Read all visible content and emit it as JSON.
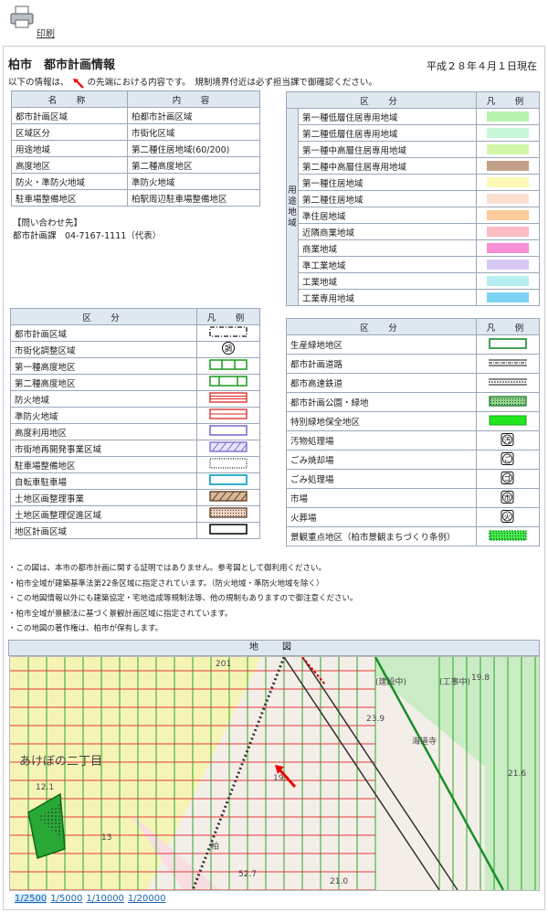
{
  "print": {
    "label": "印刷"
  },
  "header": {
    "title": "柏市　都市計画情報",
    "as_of": "平成２８年４月１日現在",
    "note_before": "以下の情報は、",
    "note_after": "の先端における内容です。　規制境界付近は必ず担当課で御確認ください。"
  },
  "info_table": {
    "headers": [
      "名　称",
      "内　容"
    ],
    "rows": [
      [
        "都市計画区域",
        "柏都市計画区域"
      ],
      [
        "区域区分",
        "市街化区域"
      ],
      [
        "用途地域",
        "第二種住居地域(60/200)"
      ],
      [
        "高度地区",
        "第二種高度地区"
      ],
      [
        "防火・準防火地域",
        "準防火地域"
      ],
      [
        "駐車場整備地区",
        "柏駅周辺駐車場整備地区"
      ]
    ]
  },
  "contact": {
    "heading": "【問い合わせ先】",
    "line": "都市計画課　04-7167-1111（代表）"
  },
  "zone_table": {
    "headers": [
      "区　分",
      "凡　例"
    ],
    "group_label": "用途地域",
    "rows": [
      {
        "label": "第一種低層住居専用地域",
        "color": "#b8f2b0"
      },
      {
        "label": "第二種低層住居専用地域",
        "color": "#c8f7d8"
      },
      {
        "label": "第一種中高層住居専用地域",
        "color": "#d3f7a8"
      },
      {
        "label": "第二種中高層住居専用地域",
        "color": "#c2a088"
      },
      {
        "label": "第一種住居地域",
        "color": "#fbf9b6"
      },
      {
        "label": "第二種住居地域",
        "color": "#fbe0d2"
      },
      {
        "label": "準住居地域",
        "color": "#fccc9c"
      },
      {
        "label": "近隣商業地域",
        "color": "#fbbcc4"
      },
      {
        "label": "商業地域",
        "color": "#f78fd6"
      },
      {
        "label": "準工業地域",
        "color": "#d8c8f4"
      },
      {
        "label": "工業地域",
        "color": "#b7eef2"
      },
      {
        "label": "工業専用地域",
        "color": "#7dd3f4"
      }
    ]
  },
  "legend_left": {
    "headers": [
      "区　分",
      "凡　例"
    ],
    "rows": [
      {
        "label": "都市計画区域",
        "icon": "dash-dot-box"
      },
      {
        "label": "市街化調整区域",
        "icon": "circle-cho-icon",
        "glyph": "調"
      },
      {
        "label": "第一種高度地区",
        "icon": "green-ladder-3"
      },
      {
        "label": "第二種高度地区",
        "icon": "green-ladder-2"
      },
      {
        "label": "防火地域",
        "icon": "red-lines-box"
      },
      {
        "label": "準防火地域",
        "icon": "red-double-box"
      },
      {
        "label": "高度利用地区",
        "icon": "purple-box"
      },
      {
        "label": "市街地再開発事業区域",
        "icon": "hatched-purple-box"
      },
      {
        "label": "駐車場整備地区",
        "icon": "dotted-box"
      },
      {
        "label": "自転車駐車場",
        "icon": "cyan-box"
      },
      {
        "label": "土地区画整理事業",
        "icon": "brown-hatch-box"
      },
      {
        "label": "土地区画整理促進区域",
        "icon": "brown-dot-box"
      },
      {
        "label": "地区計画区域",
        "icon": "black-box"
      }
    ]
  },
  "legend_right": {
    "headers": [
      "区　分",
      "凡　例"
    ],
    "rows": [
      {
        "label": "生産緑地地区",
        "icon": "green-outline-box"
      },
      {
        "label": "都市計画道路",
        "icon": "road-lines"
      },
      {
        "label": "都市高速鉄道",
        "icon": "rail-lines"
      },
      {
        "label": "都市計画公園・緑地",
        "icon": "green-dot-box"
      },
      {
        "label": "特別緑地保全地区",
        "icon": "green-fill-box"
      },
      {
        "label": "汚物処理場",
        "icon": "sq-glyph-icon",
        "glyph": "汚"
      },
      {
        "label": "ごみ焼却場",
        "icon": "sq-glyph-icon",
        "glyph": "ご"
      },
      {
        "label": "ごみ処理場",
        "icon": "sq-glyph-icon",
        "glyph": "ゴ"
      },
      {
        "label": "市場",
        "icon": "sq-glyph-icon",
        "glyph": "市"
      },
      {
        "label": "火葬場",
        "icon": "sq-glyph-icon",
        "glyph": "火"
      },
      {
        "label": "景観重点地区（柏市景観まちづくり条例）",
        "icon": "green-bright-dot-box"
      }
    ]
  },
  "notes": [
    "・この図は、本市の都市計画に関する証明ではありません。参考図として御利用ください。",
    "・柏市全域が建築基準法第22条区域に指定されています。（防火地域・準防火地域を除く）",
    "・この地図情報以外にも建築協定・宅地造成等規制法等、他の規制もありますので御注意ください。",
    "・柏市全域が景観法に基づく景観計画区域に指定されています。",
    "・この地図の著作権は、柏市が保有します。"
  ],
  "map": {
    "header": "地　図",
    "labels": [
      "あけぼの二丁目",
      "(建設中)",
      "(工事中)",
      "海道寺",
      "柏",
      "19.8",
      "23.9",
      "21.6",
      "19.",
      "12.1",
      "13",
      "52.7",
      "21.0",
      "201"
    ]
  },
  "scales": [
    "1/2500",
    "1/5000",
    "1/10000",
    "1/20000"
  ],
  "scale_active": "1/2500"
}
